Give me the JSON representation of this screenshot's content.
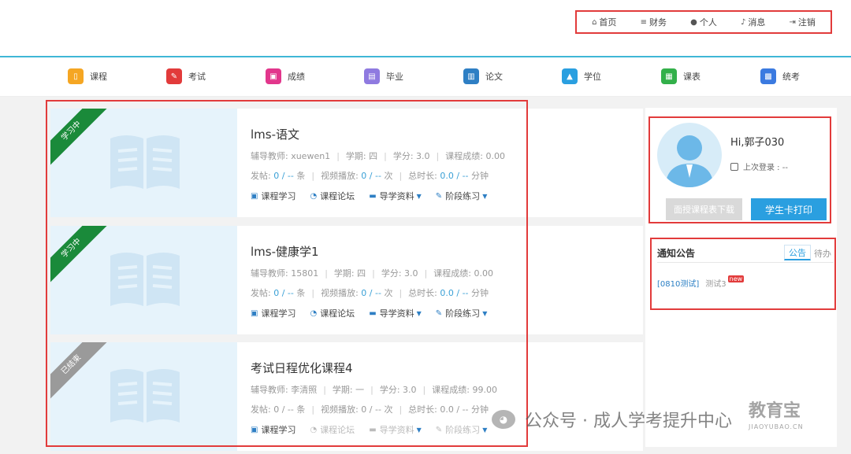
{
  "topnav": [
    {
      "label": "首页",
      "icon": "⌂"
    },
    {
      "label": "财务",
      "icon": "≡"
    },
    {
      "label": "个人",
      "icon": "●"
    },
    {
      "label": "消息",
      "icon": "♪"
    },
    {
      "label": "注销",
      "icon": "⇥"
    }
  ],
  "modules": [
    {
      "label": "课程",
      "color": "#f5a623"
    },
    {
      "label": "考试",
      "color": "#e23b3b"
    },
    {
      "label": "成绩",
      "color": "#e2368c"
    },
    {
      "label": "毕业",
      "color": "#8f7ae0"
    },
    {
      "label": "论文",
      "color": "#2e7fc4"
    },
    {
      "label": "学位",
      "color": "#2a9fe0"
    },
    {
      "label": "课表",
      "color": "#33b04a"
    },
    {
      "label": "统考",
      "color": "#3b7ae0"
    }
  ],
  "courses": [
    {
      "status": "学习中",
      "status_color": "#1a8a3a",
      "title": "lms-语文",
      "teacher": "辅导教师: xuewen1",
      "term": "学期: 四",
      "credit": "学分: 3.0",
      "score": "课程成绩: 0.00",
      "posts_label": "发帖:",
      "posts_value": "0 / --",
      "posts_unit": "条",
      "views_label": "视频播放:",
      "views_value": "0 / --",
      "views_unit": "次",
      "duration_label": "总时长:",
      "duration_value": "0.0 / --",
      "duration_unit": "分钟",
      "actions": [
        "课程学习",
        "课程论坛",
        "导学资料",
        "阶段练习"
      ]
    },
    {
      "status": "学习中",
      "status_color": "#1a8a3a",
      "title": "lms-健康学1",
      "teacher": "辅导教师: 15801",
      "term": "学期: 四",
      "credit": "学分: 3.0",
      "score": "课程成绩: 0.00",
      "posts_label": "发帖:",
      "posts_value": "0 / --",
      "posts_unit": "条",
      "views_label": "视频播放:",
      "views_value": "0 / --",
      "views_unit": "次",
      "duration_label": "总时长:",
      "duration_value": "0.0 / --",
      "duration_unit": "分钟",
      "actions": [
        "课程学习",
        "课程论坛",
        "导学资料",
        "阶段练习"
      ]
    },
    {
      "status": "已结束",
      "status_color": "#9a9a9a",
      "title": "考试日程优化课程4",
      "teacher": "辅导教师: 李清照",
      "term": "学期: 一",
      "credit": "学分: 3.0",
      "score": "课程成绩: 99.00",
      "posts_label": "发帖:",
      "posts_value": "0 / --",
      "posts_unit": "条",
      "views_label": "视频播放:",
      "views_value": "0 / --",
      "views_unit": "次",
      "duration_label": "总时长:",
      "duration_value": "0.0 / --",
      "duration_unit": "分钟",
      "actions": [
        "课程学习",
        "课程论坛",
        "导学资料",
        "阶段练习"
      ]
    }
  ],
  "profile": {
    "greeting": "Hi,郭子030",
    "last_login": "上次登录 : --",
    "download_btn": "面授课程表下载",
    "print_btn": "学生卡打印"
  },
  "notice": {
    "title": "通知公告",
    "tab_active": "公告",
    "tab_other": "待办",
    "item_tag": "[0810测试]",
    "item_text": "测试3",
    "item_badge": "new"
  },
  "watermark": {
    "text": "公众号 · 成人学考提升中心",
    "brand": "教育宝",
    "domain": "JIAOYUBAO.CN"
  }
}
